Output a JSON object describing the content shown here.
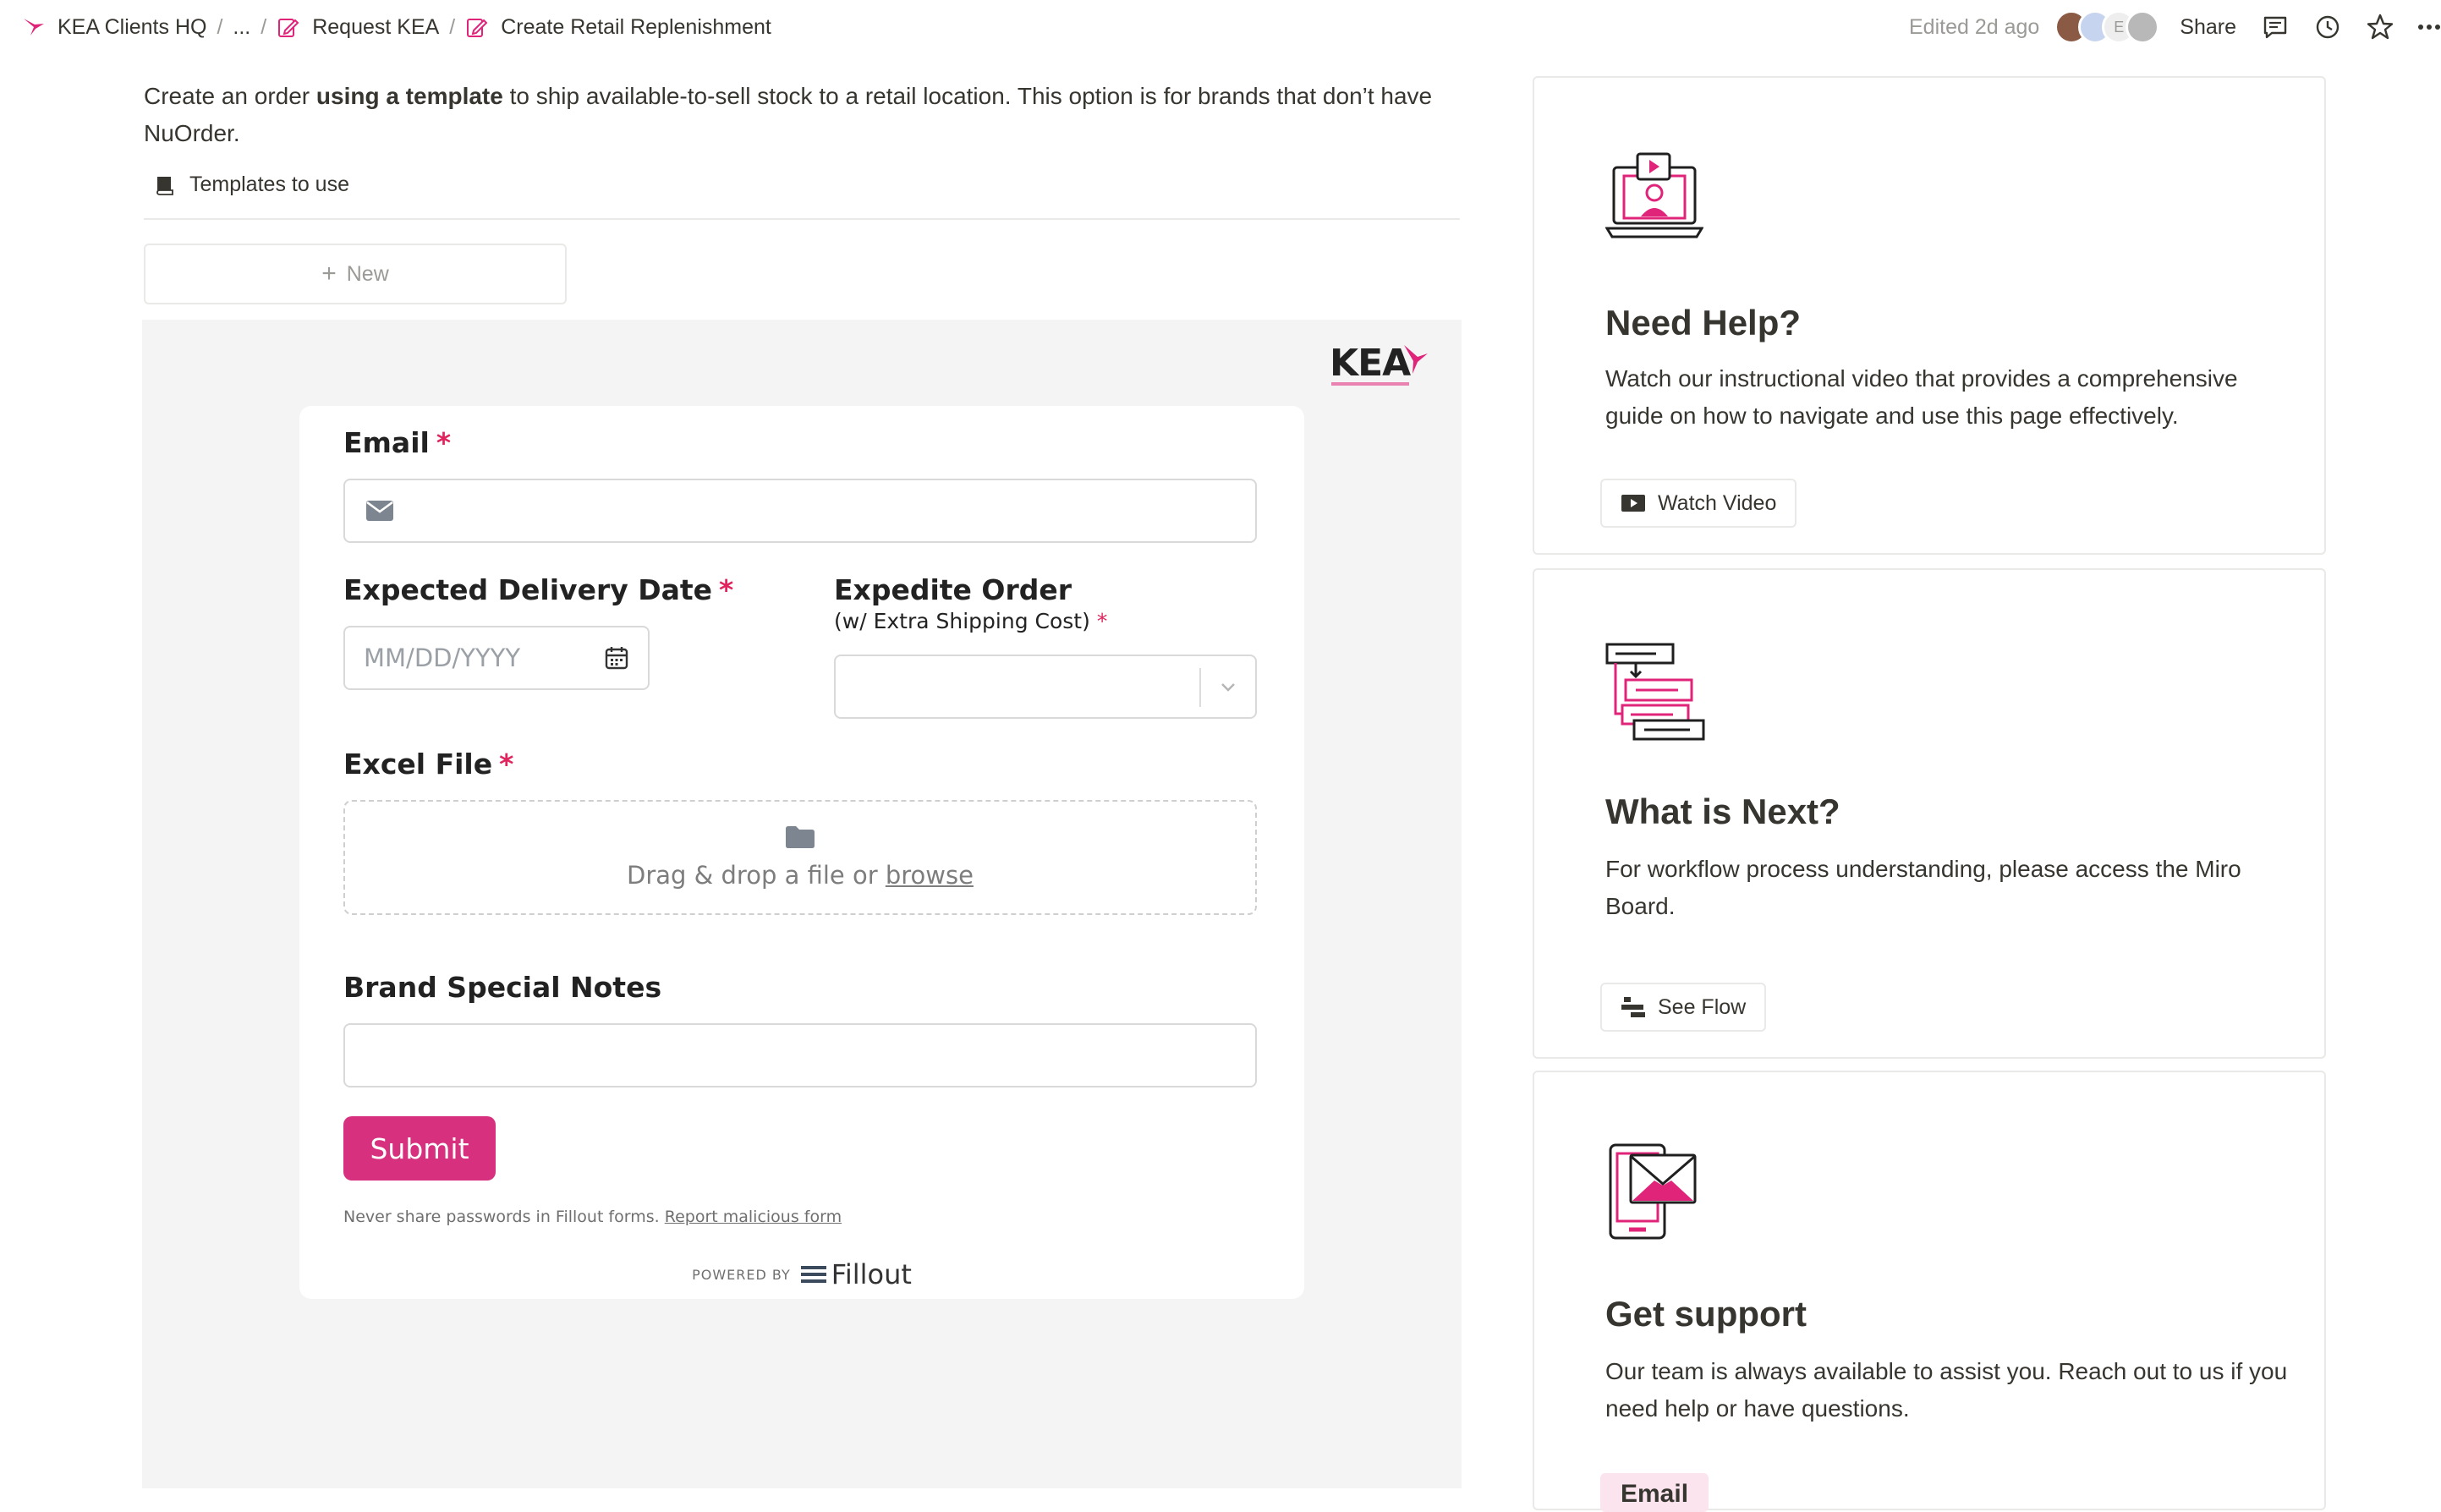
{
  "breadcrumbs": [
    {
      "label": "KEA Clients HQ"
    },
    {
      "label": "..."
    },
    {
      "label": "Request KEA"
    },
    {
      "label": "Create Retail Replenishment"
    }
  ],
  "topbar": {
    "edited": "Edited 2d ago",
    "avatar_letter": "E",
    "share_label": "Share"
  },
  "intro": {
    "part1": "Create an order ",
    "bold": "using a template",
    "part2": " to ship available-to-sell stock to a retail location. This option is for brands that don’t have NuOrder."
  },
  "templates": {
    "label": "Templates to use",
    "new_label": "New"
  },
  "form": {
    "email_label": "Email",
    "delivery_label": "Expected Delivery Date",
    "delivery_placeholder": "MM/DD/YYYY",
    "expedite_label": "Expedite Order",
    "expedite_sub": "(w/ Extra Shipping Cost)",
    "required_mark": "*",
    "excel_label": "Excel File",
    "dropzone_text": "Drag & drop a file or ",
    "dropzone_link": "browse",
    "notes_label": "Brand Special Notes",
    "submit_label": "Submit",
    "disclaimer": "Never share passwords in Fillout forms. ",
    "report_link": "Report malicious form",
    "powered_by": "POWERED BY",
    "brand": "Fillout"
  },
  "cards": [
    {
      "title": "Need Help?",
      "body": "Watch our instructional video that provides a comprehensive guide on how to navigate and use this page effectively.",
      "button": "Watch Video"
    },
    {
      "title": "What is Next?",
      "body": "For workflow process understanding, please access the Miro Board.",
      "button": "See Flow"
    },
    {
      "title": "Get support",
      "body": "Our team is always available to assist you. Reach out to us if you need help or have questions.",
      "button": "Email"
    }
  ],
  "colors": {
    "accent": "#d6307f",
    "brand_pink": "#e0247a",
    "required": "#e0245e"
  }
}
